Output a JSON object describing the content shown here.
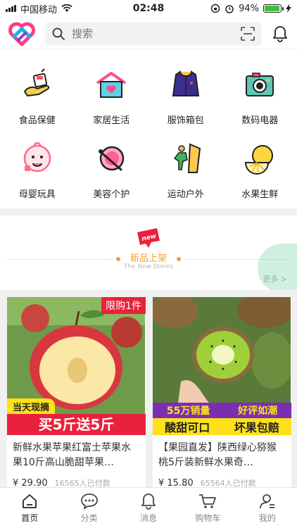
{
  "status": {
    "carrier": "中国移动",
    "time": "02:48",
    "battery": "94%",
    "battery_level": 0.94
  },
  "search": {
    "placeholder": "搜索"
  },
  "categories": [
    {
      "label": "食品保健",
      "icon": "food-health-icon"
    },
    {
      "label": "家居生活",
      "icon": "home-life-icon"
    },
    {
      "label": "服饰箱包",
      "icon": "clothing-bags-icon"
    },
    {
      "label": "数码电器",
      "icon": "digital-camera-icon"
    },
    {
      "label": "母婴玩具",
      "icon": "baby-toys-icon"
    },
    {
      "label": "美容个护",
      "icon": "beauty-care-icon"
    },
    {
      "label": "运动户外",
      "icon": "sports-outdoor-icon"
    },
    {
      "label": "水果生鲜",
      "icon": "fresh-fruit-icon"
    }
  ],
  "new_section": {
    "badge": "new",
    "title": "新品上架",
    "subtitle": "The New Stores",
    "more": "更多 >"
  },
  "products": [
    {
      "banner_top": "限购1件",
      "banner_tag": "当天现摘",
      "banner_bottom": "买5斤送5斤",
      "title": "新鲜水果苹果红富士苹果水果10斤高山脆甜苹果…",
      "price": "¥ 29.90",
      "sold": "16565人已付款"
    },
    {
      "banner_top_left": "55万销量",
      "banner_top_right": "好评如潮",
      "banner_bottom_left": "酸甜可口",
      "banner_bottom_right": "坏果包赔",
      "title": "【果园直发】陕西绿心猕猴桃5斤装新鲜水果奇…",
      "price": "¥ 15.80",
      "sold": "65564人已付款"
    }
  ],
  "tabs": [
    {
      "label": "首页",
      "icon": "home-icon",
      "active": true
    },
    {
      "label": "分类",
      "icon": "category-chat-icon",
      "active": false
    },
    {
      "label": "消息",
      "icon": "bell-icon",
      "active": false
    },
    {
      "label": "购物车",
      "icon": "cart-icon",
      "active": false
    },
    {
      "label": "我的",
      "icon": "profile-icon",
      "active": false
    }
  ]
}
